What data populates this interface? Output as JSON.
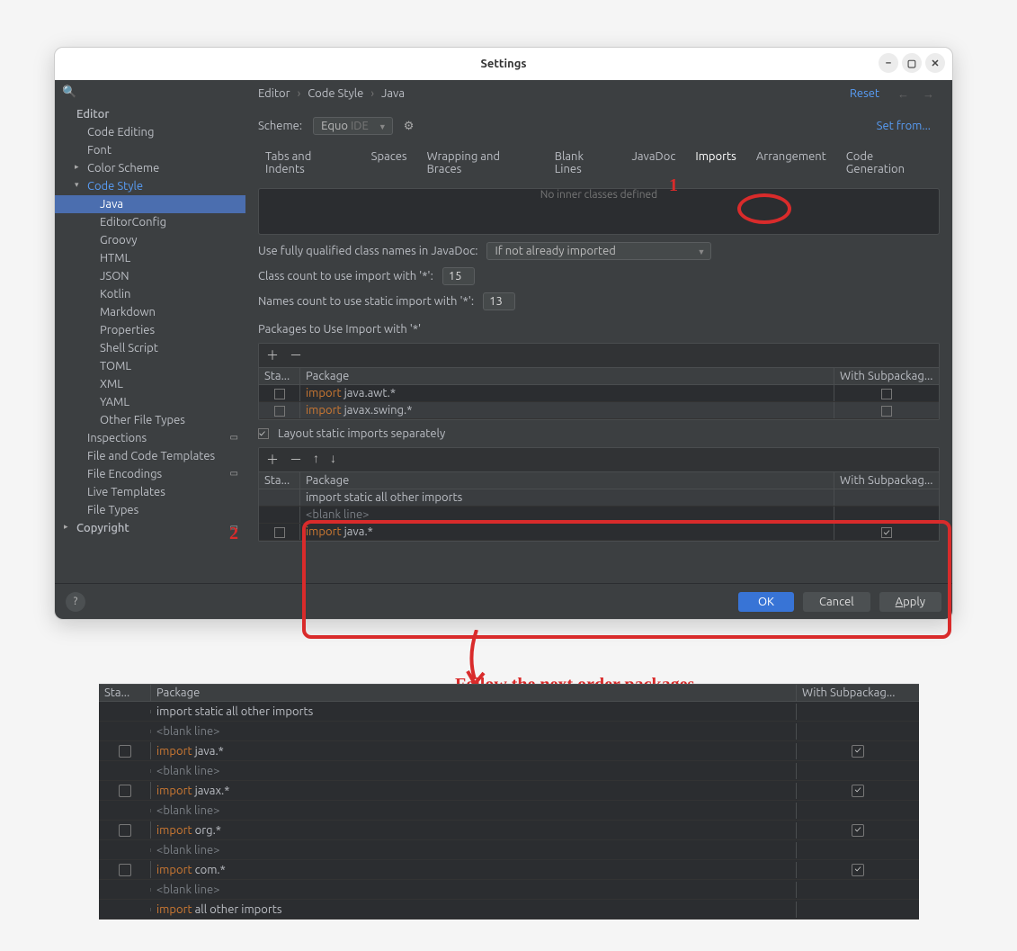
{
  "window": {
    "title": "Settings"
  },
  "sidebar": {
    "items": [
      {
        "label": "Editor",
        "level": 0
      },
      {
        "label": "Code Editing",
        "level": 1
      },
      {
        "label": "Font",
        "level": 1
      },
      {
        "label": "Color Scheme",
        "level": 1,
        "chev": ">"
      },
      {
        "label": "Code Style",
        "level": 1,
        "chev": "v",
        "accent": true
      },
      {
        "label": "Java",
        "level": 2,
        "selected": true
      },
      {
        "label": "EditorConfig",
        "level": 2
      },
      {
        "label": "Groovy",
        "level": 2
      },
      {
        "label": "HTML",
        "level": 2
      },
      {
        "label": "JSON",
        "level": 2
      },
      {
        "label": "Kotlin",
        "level": 2
      },
      {
        "label": "Markdown",
        "level": 2
      },
      {
        "label": "Properties",
        "level": 2
      },
      {
        "label": "Shell Script",
        "level": 2
      },
      {
        "label": "TOML",
        "level": 2
      },
      {
        "label": "XML",
        "level": 2
      },
      {
        "label": "YAML",
        "level": 2
      },
      {
        "label": "Other File Types",
        "level": 2
      },
      {
        "label": "Inspections",
        "level": 1,
        "mod": true
      },
      {
        "label": "File and Code Templates",
        "level": 1
      },
      {
        "label": "File Encodings",
        "level": 1,
        "mod": true
      },
      {
        "label": "Live Templates",
        "level": 1
      },
      {
        "label": "File Types",
        "level": 1
      },
      {
        "label": "Copyright",
        "level": 0,
        "chev": ">",
        "mod": true
      }
    ]
  },
  "breadcrumbs": [
    "Editor",
    "Code Style",
    "Java"
  ],
  "reset_label": "Reset",
  "scheme": {
    "label": "Scheme:",
    "value_prefix": "Equo",
    "value_suffix": "IDE"
  },
  "setfrom_label": "Set from...",
  "tabs": [
    "Tabs and Indents",
    "Spaces",
    "Wrapping and Braces",
    "Blank Lines",
    "JavaDoc",
    "Imports",
    "Arrangement",
    "Code Generation"
  ],
  "inner_box_text": "No inner classes defined",
  "rows": {
    "fqcn_label": "Use fully qualified class names in JavaDoc:",
    "fqcn_value": "If not already imported",
    "class_count_label": "Class count to use import with '*':",
    "class_count_value": "15",
    "names_count_label": "Names count to use static import with '*':",
    "names_count_value": "13"
  },
  "pkg_table": {
    "title": "Packages to Use Import with '*'",
    "head": [
      "Sta...",
      "Package",
      "With Subpackag..."
    ],
    "rows": [
      {
        "static": false,
        "pkg_kw": "import",
        "pkg_rest": " java.awt.*",
        "sub": false
      },
      {
        "static": false,
        "pkg_kw": "import",
        "pkg_rest": " javax.swing.*",
        "sub": false,
        "sel": true
      }
    ]
  },
  "layout_checkbox_label": "Layout static imports separately",
  "layout_table": {
    "head": [
      "Sta...",
      "Package",
      "With Subpackag..."
    ],
    "rows": [
      {
        "pkg_plain": "import static all other imports",
        "sel": true
      },
      {
        "pkg_blank": "<blank line>"
      },
      {
        "static": false,
        "pkg_kw": "import",
        "pkg_rest": " java.*",
        "sub": true
      }
    ]
  },
  "buttons": {
    "ok": "OK",
    "cancel": "Cancel",
    "apply": "Apply"
  },
  "annotation": {
    "num1": "1",
    "num2": "2",
    "follow": "Follow the next order packages"
  },
  "detail_table": {
    "head": [
      "Sta...",
      "Package",
      "With Subpackag..."
    ],
    "rows": [
      {
        "pkg_plain": "import static all other imports"
      },
      {
        "pkg_blank": "<blank line>"
      },
      {
        "static": false,
        "pkg_kw": "import",
        "pkg_rest": " java.*",
        "sub": true
      },
      {
        "pkg_blank": "<blank line>"
      },
      {
        "static": false,
        "pkg_kw": "import",
        "pkg_rest": " javax.*",
        "sub": true
      },
      {
        "pkg_blank": "<blank line>"
      },
      {
        "static": false,
        "pkg_kw": "import",
        "pkg_rest": " org.*",
        "sub": true
      },
      {
        "pkg_blank": "<blank line>"
      },
      {
        "static": false,
        "pkg_kw": "import",
        "pkg_rest": " com.*",
        "sub": true
      },
      {
        "pkg_blank": "<blank line>"
      },
      {
        "pkg_kw": "import",
        "pkg_rest": " all other imports"
      }
    ]
  }
}
